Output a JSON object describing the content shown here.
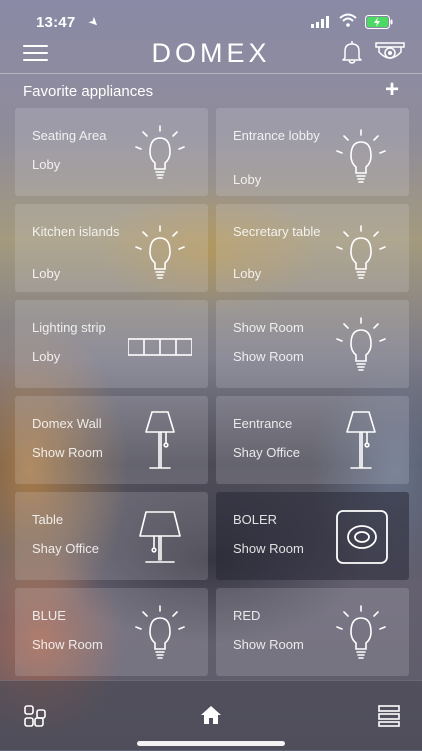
{
  "status": {
    "time": "13:47"
  },
  "header": {
    "logo": "DOMEX"
  },
  "section": {
    "title": "Favorite appliances",
    "add_label": "+"
  },
  "tiles": [
    {
      "name": "Seating Area",
      "room": "Loby",
      "icon": "bulb-icon"
    },
    {
      "name": "Entrance lobby",
      "room": "Loby",
      "icon": "bulb-icon"
    },
    {
      "name": "Kitchen islands",
      "room": "Loby",
      "icon": "bulb-icon"
    },
    {
      "name": "Secretary table",
      "room": "Loby",
      "icon": "bulb-icon"
    },
    {
      "name": "Lighting strip",
      "room": "Loby",
      "icon": "light-strip-icon"
    },
    {
      "name": "Show Room",
      "room": "Show Room",
      "icon": "bulb-icon"
    },
    {
      "name": "Domex Wall",
      "room": "Show Room",
      "icon": "floor-lamp-icon"
    },
    {
      "name": "Eentrance",
      "room": "Shay Office",
      "icon": "floor-lamp-icon"
    },
    {
      "name": "Table",
      "room": "Shay Office",
      "icon": "table-lamp-icon"
    },
    {
      "name": "BOLER",
      "room": "Show Room",
      "icon": "boiler-icon"
    },
    {
      "name": "BLUE",
      "room": "Show Room",
      "icon": "bulb-icon"
    },
    {
      "name": "RED",
      "room": "Show Room",
      "icon": "bulb-icon"
    }
  ],
  "colors": {
    "battery": "#4cd964",
    "text": "#ffffff"
  }
}
